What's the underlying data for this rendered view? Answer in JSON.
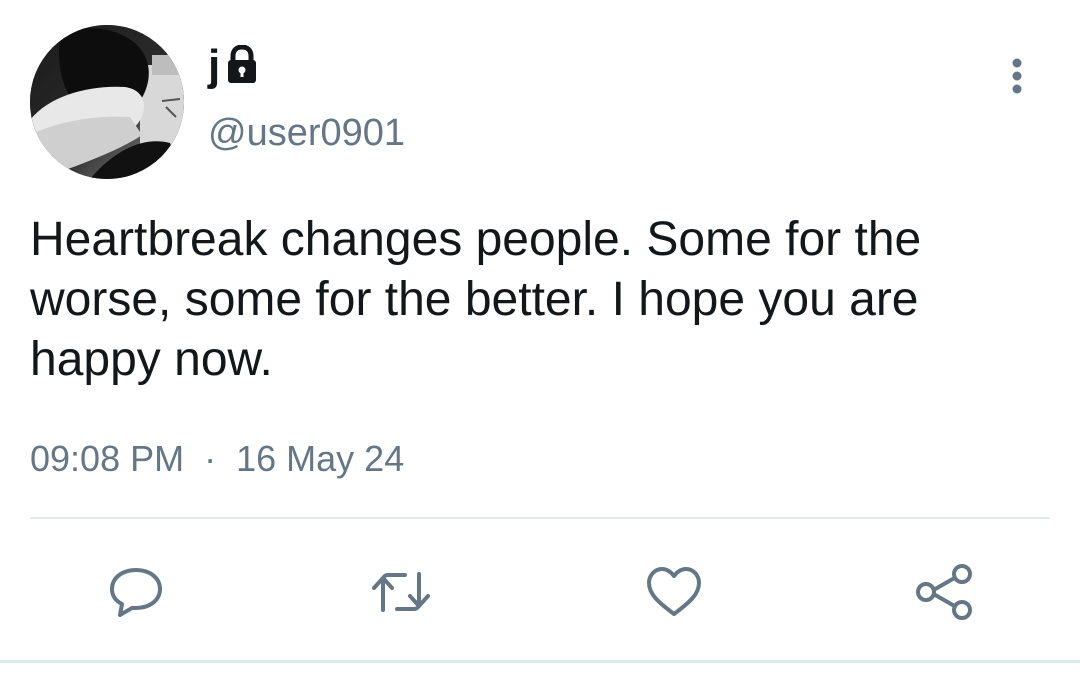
{
  "tweet": {
    "display_name": "j",
    "handle": "@user0901",
    "text": "Heartbreak changes people. Some for the worse, some for the better. I hope you are happy now.",
    "time": "09:08 PM",
    "separator": "·",
    "date": "16 May 24"
  },
  "icons": {
    "lock": "lock-icon",
    "more": "vertical-ellipsis-icon",
    "reply": "speech-bubble-icon",
    "retweet": "retweet-arrows-icon",
    "like": "heart-icon",
    "share": "share-nodes-icon"
  },
  "colors": {
    "text": "#14171a",
    "secondary": "#657786",
    "divider": "#e1e8ed"
  }
}
